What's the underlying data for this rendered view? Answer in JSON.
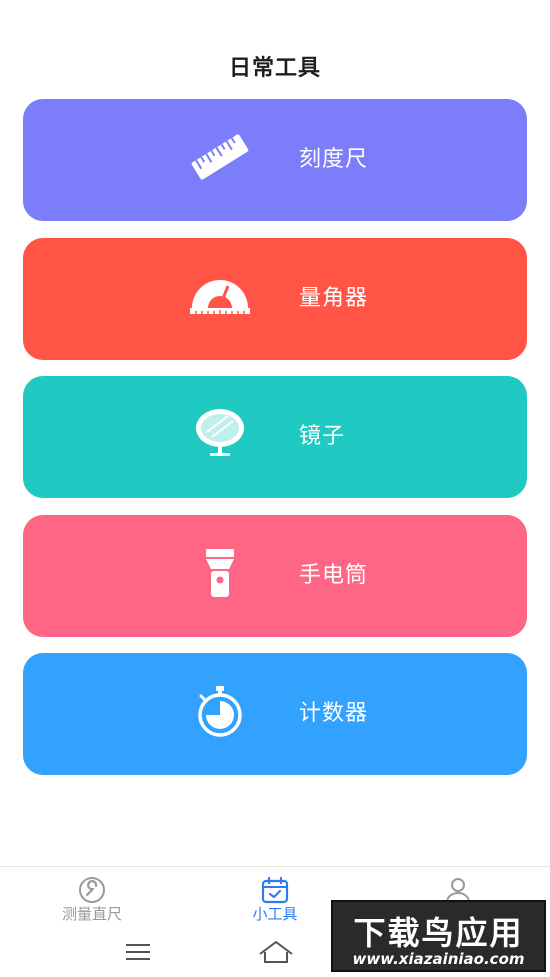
{
  "page": {
    "title": "日常工具"
  },
  "tools": [
    {
      "label": "刻度尺",
      "color": "#7b7dfb",
      "icon": "ruler-icon"
    },
    {
      "label": "量角器",
      "color": "#ff5446",
      "icon": "protractor-icon"
    },
    {
      "label": "镜子",
      "color": "#21c9c3",
      "icon": "mirror-icon"
    },
    {
      "label": "手电筒",
      "color": "#ff6585",
      "icon": "flashlight-icon"
    },
    {
      "label": "计数器",
      "color": "#33a2ff",
      "icon": "stopwatch-icon"
    }
  ],
  "tabbar": {
    "items": [
      {
        "label": "测量直尺",
        "icon": "wrench-icon",
        "active": false
      },
      {
        "label": "小工具",
        "icon": "calendar-check-icon",
        "active": true
      },
      {
        "label": "",
        "icon": "person-icon",
        "active": false
      }
    ],
    "active_color": "#2d7df0",
    "inactive_color": "#9a9a9a"
  },
  "system_nav": {
    "icons": [
      "menu-icon",
      "home-icon"
    ]
  },
  "watermark": {
    "title": "下载鸟应用",
    "url": "www.xiazainiao.com"
  }
}
